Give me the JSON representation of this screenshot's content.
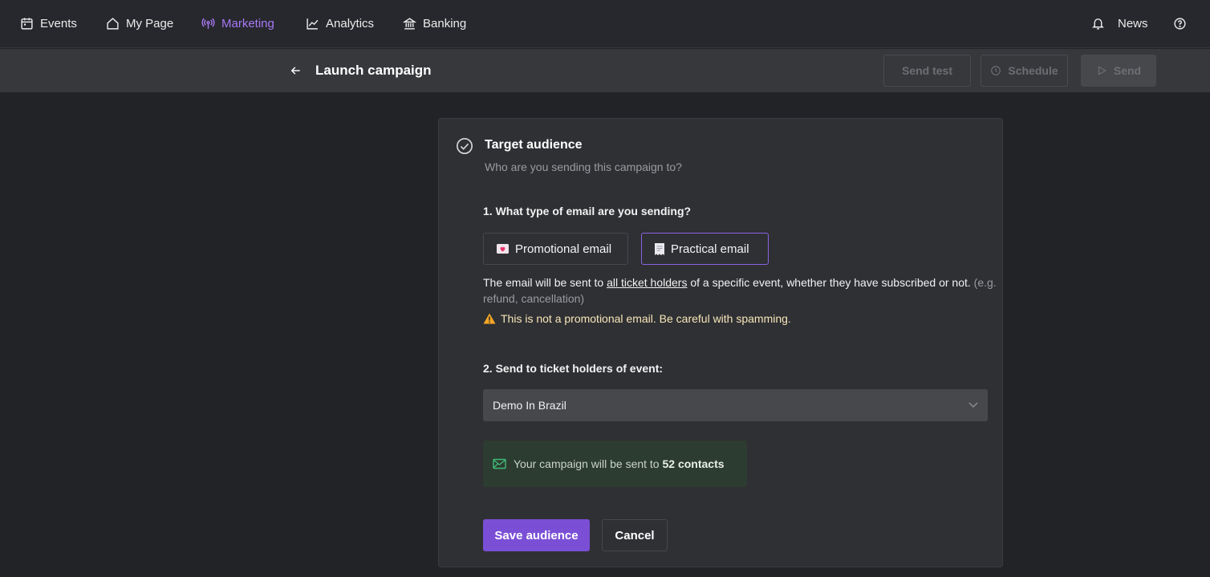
{
  "nav": {
    "items": [
      {
        "label": "Events",
        "icon": "calendar-icon"
      },
      {
        "label": "My Page",
        "icon": "home-icon"
      },
      {
        "label": "Marketing",
        "icon": "broadcast-icon",
        "active": true
      },
      {
        "label": "Analytics",
        "icon": "chart-line-icon"
      },
      {
        "label": "Banking",
        "icon": "bank-icon"
      }
    ],
    "news_label": "News",
    "accent_color": "#a878f5"
  },
  "header": {
    "title": "Launch campaign",
    "send_test_label": "Send test",
    "schedule_label": "Schedule",
    "send_label": "Send"
  },
  "card": {
    "title": "Target audience",
    "subtitle": "Who are you sending this campaign to?",
    "question1": "1. What type of email are you sending?",
    "promotional_label": "Promotional email",
    "practical_label": "Practical email",
    "selected_type": "Practical email",
    "desc_prefix": "The email will be sent to ",
    "desc_link": "all ticket holders",
    "desc_suffix": " of a specific event, whether they have subscribed or not.",
    "desc_example": "(e.g. refund, cancellation)",
    "warning": "This is not a promotional email. Be careful with spamming.",
    "question2": "2. Send to ticket holders of event:",
    "event_selected": "Demo In Brazil",
    "notice_prefix": "Your campaign will be sent to ",
    "notice_count": "52 contacts",
    "save_label": "Save audience",
    "cancel_label": "Cancel"
  },
  "colors": {
    "primary": "#7a4fd6",
    "warning": "#f5a623",
    "success": "#3fb97a"
  }
}
